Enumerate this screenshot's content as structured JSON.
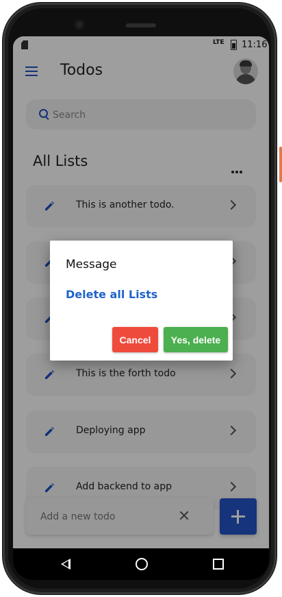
{
  "status_bar": {
    "network": "LTE",
    "time": "11:16"
  },
  "app": {
    "title": "Todos",
    "search_placeholder": "Search",
    "section_title": "All Lists"
  },
  "todos": [
    {
      "label": "This is another todo."
    },
    {
      "label": ""
    },
    {
      "label": ""
    },
    {
      "label": "This is the forth todo"
    },
    {
      "label": "Deploying app"
    },
    {
      "label": "Add backend to app"
    }
  ],
  "new_todo": {
    "placeholder": "Add a new todo"
  },
  "dialog": {
    "title": "Message",
    "message": "Delete all Lists",
    "cancel_label": "Cancel",
    "confirm_label": "Yes, delete"
  },
  "colors": {
    "accent": "#1f4fc4",
    "fab": "#2455c8",
    "cancel": "#ef4b3c",
    "confirm": "#4caf50",
    "dialog_message": "#1f63c9"
  }
}
